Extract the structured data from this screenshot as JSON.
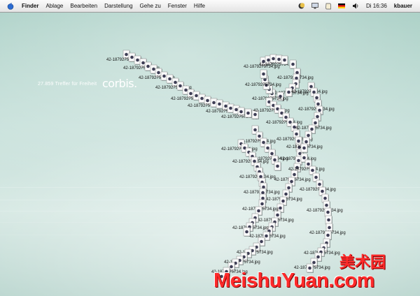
{
  "menubar": {
    "apple_icon": "apple-icon",
    "items": [
      "Finder",
      "Ablage",
      "Bearbeiten",
      "Darstellung",
      "Gehe zu",
      "Fenster",
      "Hilfe"
    ],
    "status": {
      "clock": "Di 16:36",
      "user": "kbauer",
      "flag_icon": "german-flag-icon",
      "volume_icon": "volume-icon",
      "extra_icons": [
        "moon-icon",
        "display-icon",
        "script-icon"
      ]
    }
  },
  "desktop": {
    "tagline": "27.859 Treffer für Freiheit",
    "logo": "corbis.",
    "file_label": "42-1879275734.jpg"
  },
  "watermark": {
    "text": "MeishuYuan.com",
    "cn": "美术园"
  },
  "colors": {
    "wallpaper": "#bcd7d0",
    "watermark": "#ff2a2a"
  }
}
